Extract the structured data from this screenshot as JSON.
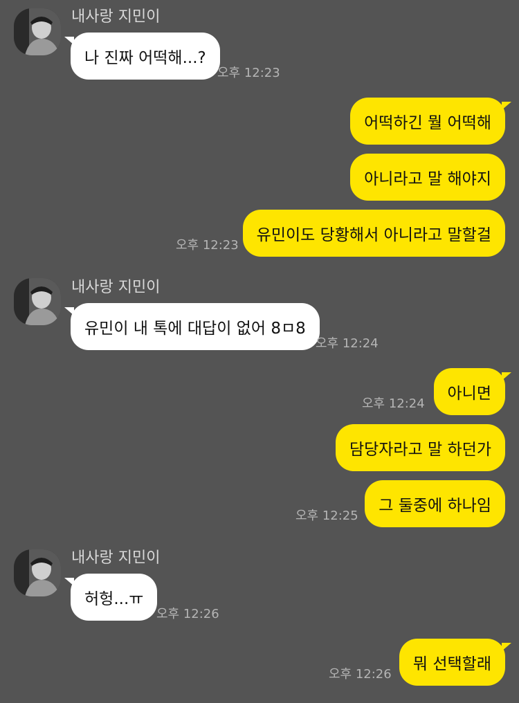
{
  "colors": {
    "background": "#545454",
    "incoming_bubble": "#ffffff",
    "outgoing_bubble": "#fee500"
  },
  "icons": {
    "avatar": "profile-photo"
  },
  "messages": [
    {
      "sender": "내사랑 지민이",
      "text": "나 진짜 어떡해...?",
      "time": "오후 12:23"
    },
    {
      "text": "어떡하긴 뭘 어떡해"
    },
    {
      "text": "아니라고 말 해야지"
    },
    {
      "text": "유민이도 당황해서 아니라고 말할걸",
      "time": "오후 12:23"
    },
    {
      "sender": "내사랑 지민이",
      "text": "유민이 내 톡에 대답이 없어 8ㅁ8",
      "time": "오후 12:24"
    },
    {
      "text": "아니면",
      "time": "오후 12:24"
    },
    {
      "text": "담당자라고 말 하던가"
    },
    {
      "text": "그 둘중에 하나임",
      "time": "오후 12:25"
    },
    {
      "sender": "내사랑 지민이",
      "text": "허헝...ㅠ",
      "time": "오후 12:26"
    },
    {
      "text": "뭐 선택할래",
      "time": "오후 12:26"
    }
  ]
}
